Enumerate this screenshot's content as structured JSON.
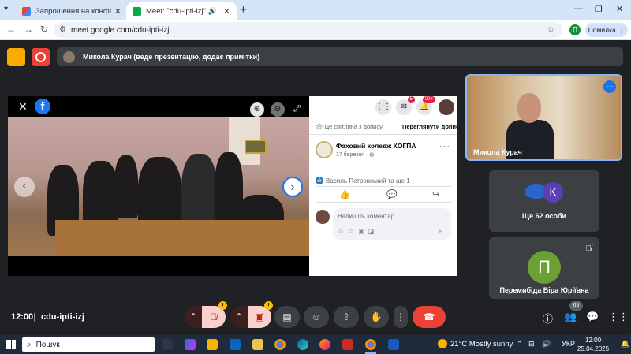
{
  "browser": {
    "tabs": [
      {
        "title": "Запрошення на конференцію"
      },
      {
        "title": "Meet: \"cdu-ipti-izj\""
      }
    ],
    "url": "meet.google.com/cdu-ipti-izj",
    "profile_initial": "П",
    "error_button": "Помилка"
  },
  "meet": {
    "presenter_banner": "Микола Курач (веде презентацію, додає примітки)",
    "facebook": {
      "hidden_notice": "Це світлина з допису",
      "view_post": "Переглянути допис",
      "page_name": "Фаховий коледж КОГПА",
      "date": "17 березня",
      "likes_text": "Василь Петровський та ще 1",
      "comment_placeholder": "Напишіть коментар...",
      "messenger_badge": "5",
      "notif_badge": "20+"
    },
    "tiles": {
      "self_name": "Микола Курач",
      "others_label": "Ще 62 особи",
      "others_initial": "K",
      "participant_name": "Перемибіда Віра Юріївна",
      "participant_initial": "П"
    },
    "bottom": {
      "time": "12:00",
      "separator": "|",
      "meeting_code": "cdu-ipti-izj",
      "participants_count": "65"
    }
  },
  "taskbar": {
    "search_label": "Пошук",
    "weather": "21°C  Mostly sunny",
    "lang": "УКР",
    "time": "12:00",
    "date": "25.04.2025"
  }
}
